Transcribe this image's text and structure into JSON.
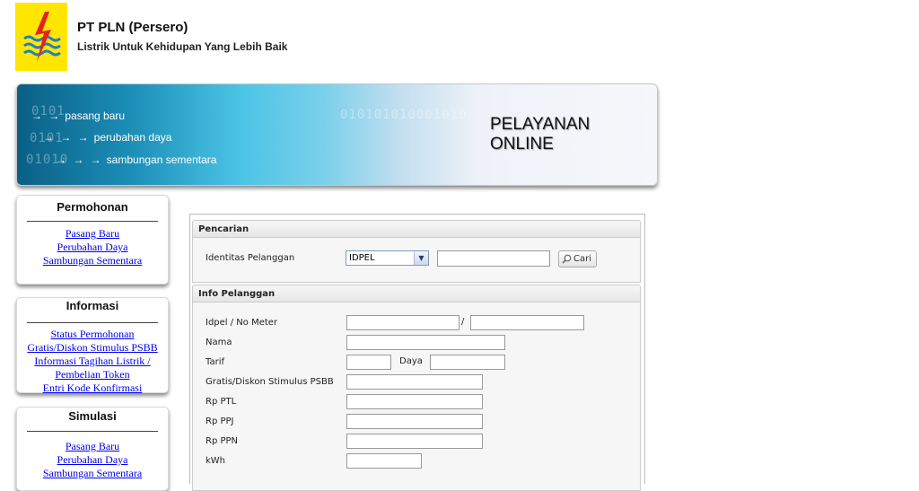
{
  "header": {
    "company": "PT PLN (Persero)",
    "slogan": "Listrik Untuk Kehidupan Yang Lebih Baik",
    "logo_color": "#ffe600"
  },
  "banner": {
    "links": [
      "pasang baru",
      "perubahan daya",
      "sambungan sementara"
    ],
    "title_line1": "PELAYANAN",
    "title_line2": "ONLINE"
  },
  "sidebar": {
    "permohonan": {
      "title": "Permohonan",
      "items": [
        "Pasang Baru",
        "Perubahan Daya",
        "Sambungan Sementara"
      ]
    },
    "informasi": {
      "title": "Informasi",
      "items": [
        "Status Permohonan",
        "Gratis/Diskon Stimulus PSBB",
        "Informasi Tagihan Listrik /",
        "Pembelian Token",
        "Entri Kode Konfirmasi"
      ]
    },
    "simulasi": {
      "title": "Simulasi",
      "items": [
        "Pasang Baru",
        "Perubahan Daya",
        "Sambungan Sementara"
      ]
    }
  },
  "search": {
    "heading": "Pencarian",
    "label": "Identitas Pelanggan",
    "select_value": "IDPEL",
    "input_value": "",
    "button_label": "Cari"
  },
  "info": {
    "heading": "Info Pelanggan",
    "idpel_label": "Idpel / No Meter",
    "separator": "/",
    "nama_label": "Nama",
    "tarif_label": "Tarif",
    "daya_label": "Daya",
    "gratis_label": "Gratis/Diskon Stimulus PSBB",
    "ptl_label": "Rp PTL",
    "ppj_label": "Rp PPJ",
    "ppn_label": "Rp PPN",
    "kwh_label": "kWh"
  }
}
